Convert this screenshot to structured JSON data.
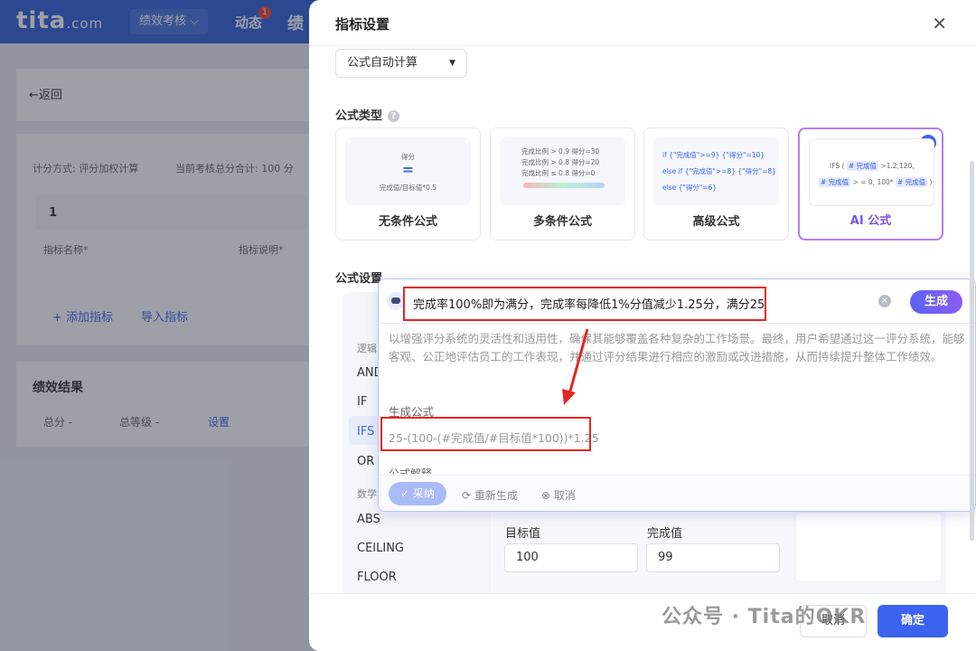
{
  "app": {
    "logo": "tita",
    "logo_suffix": ".com",
    "nav_menu": "绩效考核 ⌵",
    "nav_dynamic": "动态",
    "nav_badge": "1",
    "nav_more": "绩",
    "back": "←返回",
    "calc_method": "计分方式: 评分加权计算",
    "total_weight": "当前考核总分合计: 100 分",
    "table_group": "1",
    "col_name": "指标名称*",
    "col_desc": "指标说明*",
    "add_metric": "+ 添加指标",
    "import_metric": "导入指标",
    "result_title": "绩效结果",
    "total_score": "总分  -",
    "total_grade": "总等级  -",
    "settings_link": "设置"
  },
  "drawer": {
    "title": "指标设置",
    "calc_select": "公式自动计算",
    "formula_type_label": "公式类型",
    "formula_setting_label": "公式设置",
    "cards": [
      {
        "label": "无条件公式",
        "thumb_lines": [
          "得分",
          "=",
          "完成值/目标值*0.5"
        ]
      },
      {
        "label": "多条件公式",
        "thumb_lines": [
          "完成比例 > 0.9    得分=30",
          "完成比例 > 0.8    得分=20",
          "完成比例 ≤ 0.8    得分=0"
        ]
      },
      {
        "label": "高级公式",
        "thumb_lines": [
          "if {\"完成值\">=9} {\"得分\"=10}",
          "else if {\"完成值\">=8} {\"得分\"=8}",
          "else {\"得分\"=6}"
        ]
      },
      {
        "label": "AI 公式",
        "thumb_lines": [
          "IFS (",
          "# 完成值",
          ">1.2,120,",
          "# 完成值",
          "> = 0, 100*",
          "# 完成值",
          ")"
        ],
        "selected": true
      }
    ],
    "functions": {
      "cat_logic": "逻辑",
      "cat_math": "数学",
      "items": [
        "AND",
        "IF",
        "IFS",
        "OR",
        "ABS",
        "CEILING",
        "FLOOR"
      ],
      "active": "IFS"
    },
    "target_label": "目标值",
    "target_value": "100",
    "actual_label": "完成值",
    "actual_value": "99",
    "cancel": "取消",
    "ok": "确定"
  },
  "ai_popup": {
    "prompt": "完成率100%即为满分，完成率每降低1%分值减少1.25分，满分25",
    "generate": "生成",
    "description": "以增强评分系统的灵活性和适用性，确保其能够覆盖各种复杂的工作场景。最终，用户希望通过这一评分系统，能够客观、公正地评估员工的工作表现，并通过评分结果进行相应的激励或改进措施，从而持续提升整体工作绩效。",
    "generated_label": "生成公式",
    "generated_formula": "25-(100-(#完成值/#目标值*100))*1.25",
    "explain_label": "公式解释",
    "accept": "采纳",
    "regenerate": "重新生成",
    "cancel": "取消"
  },
  "watermark": "公众号 · Tita的OKR",
  "colors": {
    "primary": "#3b63f0",
    "topbar": "#2f5fd7",
    "ai_purple": "#7b52e8",
    "annotation_red": "#e8261f"
  }
}
